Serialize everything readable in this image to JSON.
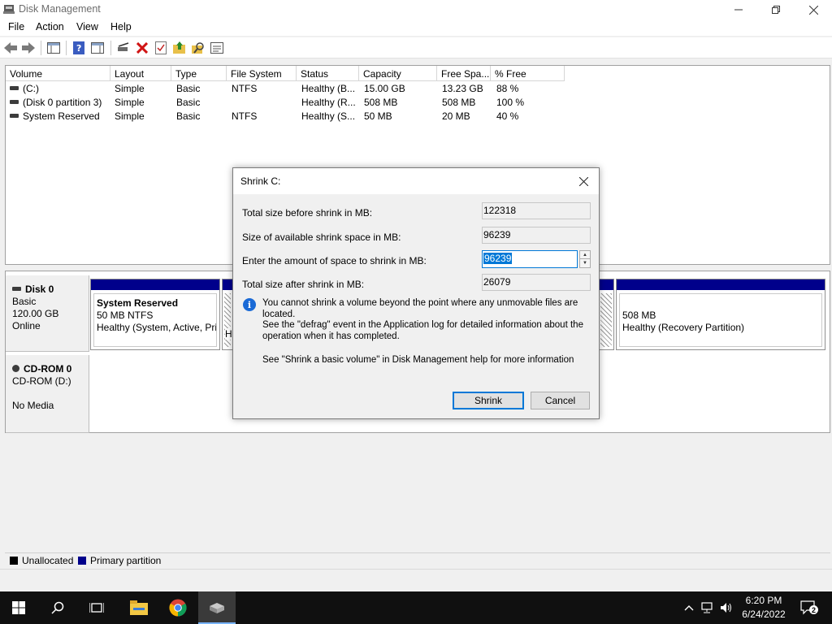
{
  "window": {
    "title": "Disk Management",
    "controls": {
      "minimize": "—",
      "maximize": "❐",
      "close": "✕"
    }
  },
  "menu": [
    "File",
    "Action",
    "View",
    "Help"
  ],
  "toolbar_icons": [
    "back-icon",
    "forward-icon",
    "console-tree-icon",
    "help-icon",
    "action-pane-icon",
    "connect-drive-icon",
    "delete-icon",
    "checklist-icon",
    "folder-up-icon",
    "search-folder-icon",
    "properties-icon"
  ],
  "volume_list": {
    "columns": [
      "Volume",
      "Layout",
      "Type",
      "File System",
      "Status",
      "Capacity",
      "Free Spa...",
      "% Free"
    ],
    "rows": [
      {
        "volume": "(C:)",
        "layout": "Simple",
        "type": "Basic",
        "fs": "NTFS",
        "status": "Healthy (B...",
        "capacity": "15.00 GB",
        "free": "13.23 GB",
        "pct": "88 %"
      },
      {
        "volume": "(Disk 0 partition 3)",
        "layout": "Simple",
        "type": "Basic",
        "fs": "",
        "status": "Healthy (R...",
        "capacity": "508 MB",
        "free": "508 MB",
        "pct": "100 %"
      },
      {
        "volume": "System Reserved",
        "layout": "Simple",
        "type": "Basic",
        "fs": "NTFS",
        "status": "Healthy (S...",
        "capacity": "50 MB",
        "free": "20 MB",
        "pct": "40 %"
      }
    ]
  },
  "disks": {
    "disk0": {
      "name": "Disk 0",
      "type": "Basic",
      "size": "120.00 GB",
      "state": "Online"
    },
    "cdrom0": {
      "name": "CD-ROM 0",
      "type": "CD-ROM (D:)",
      "media": "No Media"
    },
    "partitions": {
      "system_reserved": {
        "title": "System Reserved",
        "size": "50 MB NTFS",
        "status": "Healthy (System, Active, Pri"
      },
      "recovery": {
        "size": "508 MB",
        "status": "Healthy (Recovery Partition)"
      },
      "c_fragment": "H"
    }
  },
  "legend": {
    "unallocated": "Unallocated",
    "primary": "Primary partition",
    "colors": {
      "unallocated": "#000000",
      "primary": "#00008b"
    }
  },
  "dialog": {
    "title": "Shrink C:",
    "total_before_label": "Total size before shrink in MB:",
    "total_before_value": "122318",
    "available_label": "Size of available shrink space in MB:",
    "available_value": "96239",
    "amount_label": "Enter the amount of space to shrink in MB:",
    "amount_value": "96239",
    "total_after_label": "Total size after shrink in MB:",
    "total_after_value": "26079",
    "info_line1": "You cannot shrink a volume beyond the point where any unmovable files are located.",
    "info_line2": "See the \"defrag\" event in the Application log for detailed information about the",
    "info_line3": "operation when it has completed.",
    "help_text": "See \"Shrink a basic volume\" in Disk Management help for more information",
    "shrink_button": "Shrink",
    "cancel_button": "Cancel"
  },
  "taskbar": {
    "time": "6:20 PM",
    "date": "6/24/2022",
    "notification_count": "2"
  }
}
